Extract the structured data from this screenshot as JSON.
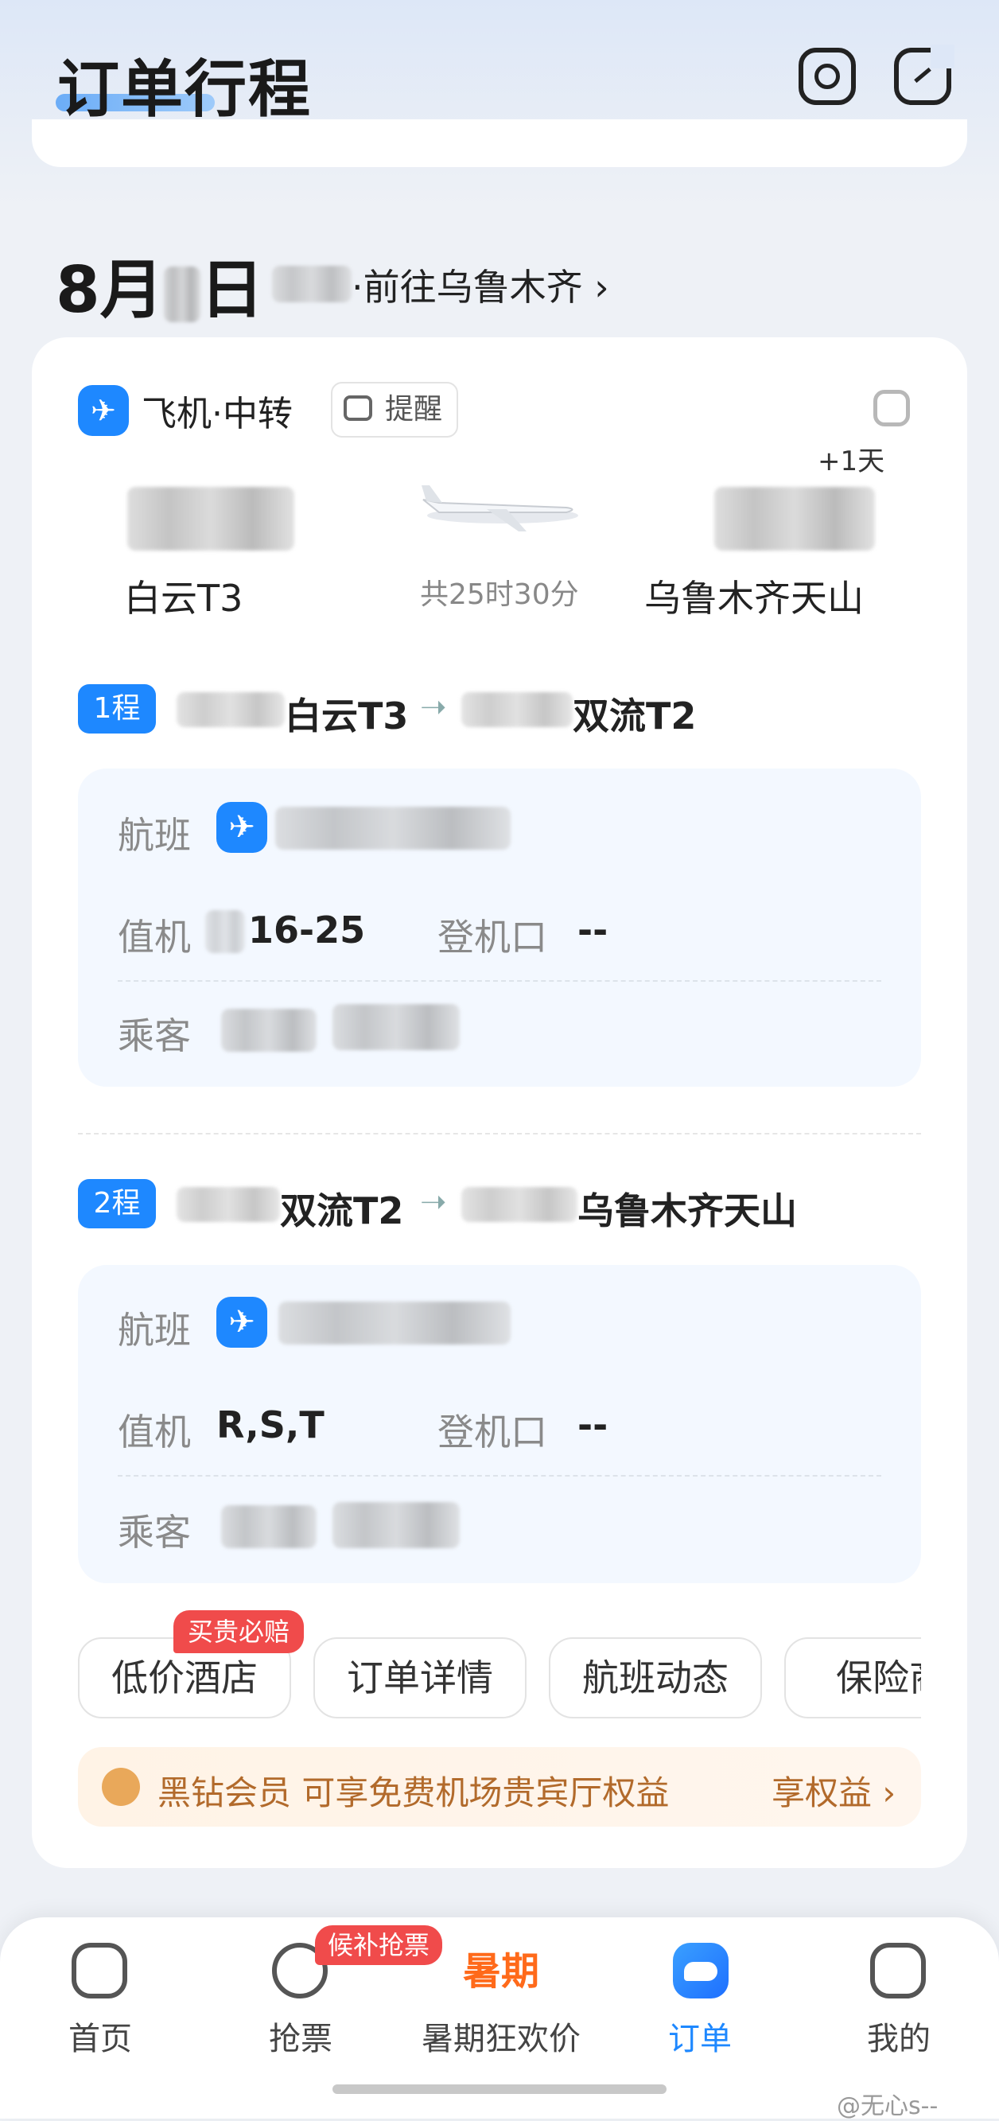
{
  "header": {
    "title": "订单行程"
  },
  "trip": {
    "date_prefix": "8月",
    "date_suffix": "日",
    "destination": "·前往乌鲁木齐",
    "chevron": "›"
  },
  "card": {
    "type_icon": "airplane-icon",
    "type_label": "飞机·中转",
    "remind_label": "提醒",
    "plus_day": "+1天",
    "depart_terminal": "白云T3",
    "duration": "共25时30分",
    "arrive_terminal": "乌鲁木齐天山"
  },
  "legs": [
    {
      "badge": "1程",
      "from": "白云T3",
      "arrow": "➝",
      "to": "双流T2",
      "flight_label": "航班",
      "checkin_label": "值机",
      "checkin_value": "16-25",
      "gate_label": "登机口",
      "gate_value": "--",
      "passenger_label": "乘客"
    },
    {
      "badge": "2程",
      "from": "双流T2",
      "arrow": "➝",
      "to": "乌鲁木齐天山",
      "flight_label": "航班",
      "checkin_label": "值机",
      "checkin_value": "R,S,T",
      "gate_label": "登机口",
      "gate_value": "--",
      "passenger_label": "乘客"
    }
  ],
  "actions": {
    "hotel": "低价酒店",
    "hotel_badge": "买贵必赔",
    "order_detail": "订单详情",
    "flight_status": "航班动态",
    "insurance": "保险商"
  },
  "vip": {
    "text": "黑钻会员 可享免费机场贵宾厅权益",
    "link": "享权益 ›"
  },
  "tabbar": {
    "home": "首页",
    "grab": "抢票",
    "grab_badge": "候补抢票",
    "summer": "暑期狂欢价",
    "summer_icon_text": "暑期",
    "orders": "订单",
    "mine": "我的"
  },
  "colors": {
    "accent": "#1e88ff",
    "vip": "#b26a2b",
    "badge_red": "#f04b4b"
  },
  "watermark": "@无心s--"
}
